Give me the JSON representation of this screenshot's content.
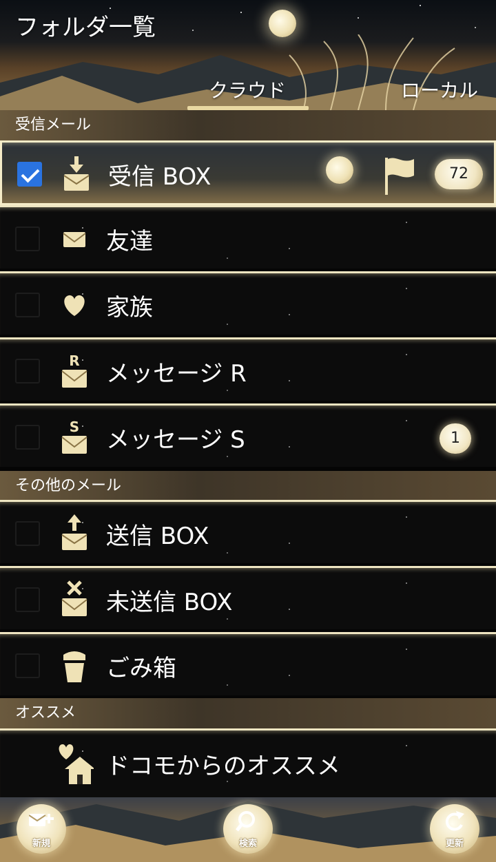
{
  "header": {
    "title": "フォルダ一覧",
    "tabs": [
      {
        "label": "クラウド",
        "active": true
      },
      {
        "label": "ローカル",
        "active": false
      }
    ]
  },
  "sections": [
    {
      "title": "受信メール",
      "items": [
        {
          "label": "受信 BOX",
          "icon": "inbox-download-icon",
          "checked": true,
          "badge": "72",
          "selected": true
        },
        {
          "label": "友達",
          "icon": "envelope-icon",
          "checked": false
        },
        {
          "label": "家族",
          "icon": "heart-icon",
          "checked": false
        },
        {
          "label": "メッセージ R",
          "icon": "message-r-icon",
          "checked": false
        },
        {
          "label": "メッセージ S",
          "icon": "message-s-icon",
          "checked": false,
          "badge": "1"
        }
      ]
    },
    {
      "title": "その他のメール",
      "items": [
        {
          "label": "送信 BOX",
          "icon": "outbox-upload-icon",
          "checked": false
        },
        {
          "label": "未送信 BOX",
          "icon": "unsent-x-icon",
          "checked": false
        },
        {
          "label": "ごみ箱",
          "icon": "trash-icon",
          "checked": false
        }
      ]
    },
    {
      "title": "オススメ",
      "items": [
        {
          "label": "ドコモからのオススメ",
          "icon": "heart-house-icon"
        }
      ]
    }
  ],
  "bottom_bar": {
    "new_label": "新規",
    "search_label": "検索",
    "refresh_label": "更新"
  },
  "colors": {
    "accent_gold": "#e9d8a2",
    "checkbox_blue": "#2a73e0",
    "row_background": "#0c0c0c"
  }
}
